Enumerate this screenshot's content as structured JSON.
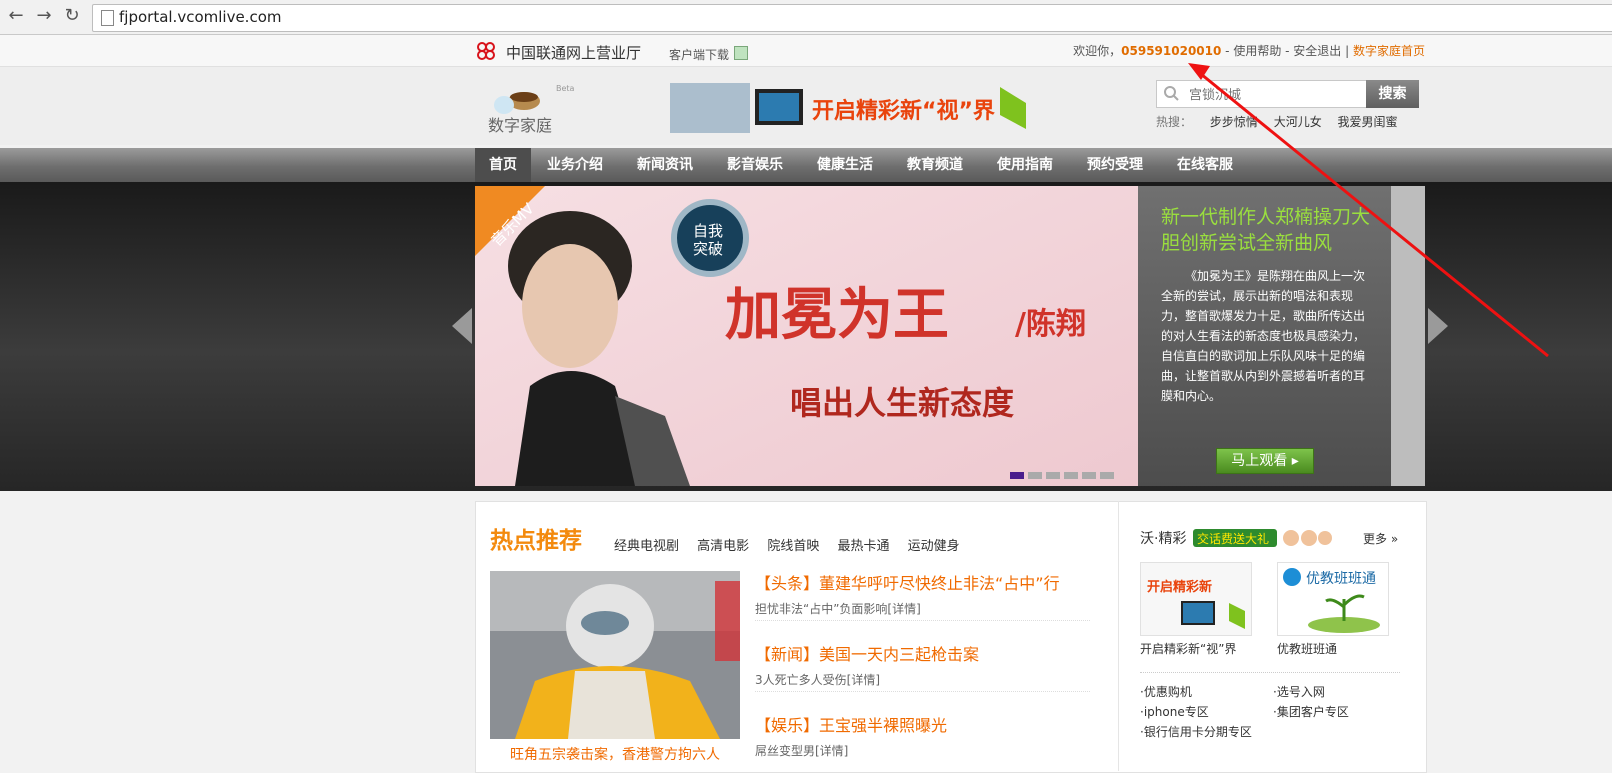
{
  "browser": {
    "url": "fjportal.vcomlive.com"
  },
  "topbar": {
    "site_name": "中国联通网上营业厅",
    "client_download": "客户端下载",
    "welcome": "欢迎你，",
    "phone": "059591020010",
    "sep1": " - ",
    "help": "使用帮助",
    "sep2": " - ",
    "logout": "安全退出",
    "sep3": " | ",
    "home_link": "数字家庭首页"
  },
  "header": {
    "logo_text": "数字家庭",
    "logo_beta": "Beta",
    "ad_text": "开启精彩新“视”界",
    "search_placeholder": "宫锁沉城",
    "search_button": "搜索",
    "hot_label": "热搜：",
    "hot_keywords": [
      "步步惊情",
      "大河儿女",
      "我爱男闺蜜"
    ]
  },
  "nav": {
    "items": [
      "首页",
      "业务介绍",
      "新闻资讯",
      "影音娱乐",
      "健康生活",
      "教育频道",
      "使用指南",
      "预约受理",
      "在线客服"
    ]
  },
  "hero": {
    "ribbon": "音乐MV",
    "song_title": "加冕为王",
    "artist": "/陈翔",
    "slogan": "唱出人生新态度",
    "badge": "自我突破",
    "headline": "新一代制作人郑楠操刀大胆创新尝试全新曲风",
    "description": "《加冕为王》是陈翔在曲风上一次全新的尝试，展示出新的唱法和表现力，整首歌爆发力十足，歌曲所传达出的对人生看法的新态度也极具感染力，自信直白的歌词加上乐队风味十足的编曲，让整首歌从内到外震撼着听者的耳膜和内心。",
    "watch_button": "马上观看 ▸",
    "dots": 6,
    "active_dot": 0
  },
  "hot": {
    "title": "热点推荐",
    "tabs": [
      "经典电视剧",
      "高清电影",
      "院线首映",
      "最热卡通",
      "运动健身"
    ],
    "image_caption": "旺角五宗袭击案，香港警方拘六人",
    "news": [
      {
        "title": "【头条】董建华呼吁尽快终止非法“占中”行",
        "summary": "担忧非法“占中”负面影响[详情]"
      },
      {
        "title": "【新闻】美国一天内三起枪击案",
        "summary": "3人死亡多人受伤[详情]"
      },
      {
        "title": "【娱乐】王宝强半裸照曝光",
        "summary": "屌丝变型男[详情]"
      }
    ]
  },
  "wo": {
    "title": "沃·精彩",
    "badge": "交话费送大礼",
    "more": "更多",
    "thumbs": [
      {
        "caption": "开启精彩新“视”界"
      },
      {
        "caption": "优教班班通"
      }
    ],
    "thumb2_label": "优教班班通",
    "links_left": [
      "·优惠购机",
      "·iphone专区",
      "·银行信用卡分期专区"
    ],
    "links_right": [
      "·选号入网",
      "·集团客户专区"
    ]
  },
  "colors": {
    "accent": "#f06a00",
    "headline_green": "#9adf3e",
    "nav_active": "#4d4d4d"
  }
}
